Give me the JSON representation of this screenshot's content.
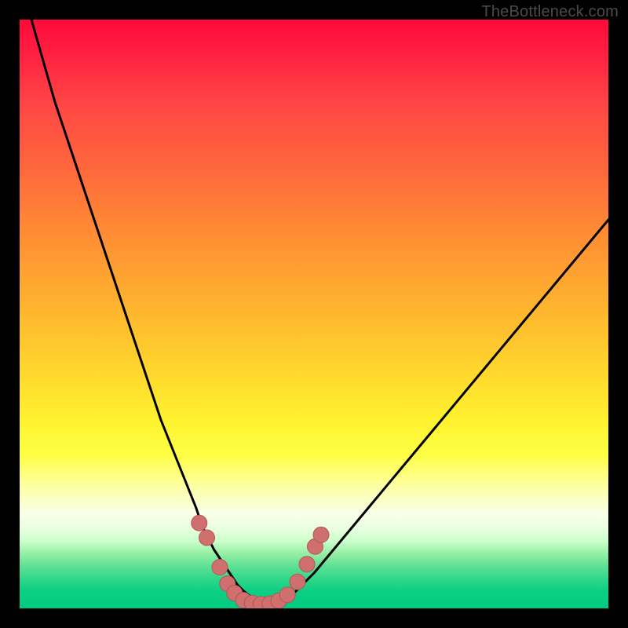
{
  "watermark": {
    "text": "TheBottleneck.com"
  },
  "colors": {
    "frame": "#000000",
    "curve": "#000000",
    "marker_fill": "#cf6f6e",
    "marker_stroke": "#b35655",
    "gradient_top": "#ff0a3a",
    "gradient_bottom": "#00cb80"
  },
  "chart_data": {
    "type": "line",
    "title": "",
    "xlabel": "",
    "ylabel": "",
    "xlim": [
      0,
      100
    ],
    "ylim": [
      0,
      100
    ],
    "grid": false,
    "legend": false,
    "series": [
      {
        "name": "bottleneck-curve",
        "x": [
          2,
          4,
          6,
          8,
          10,
          12,
          14,
          16,
          18,
          20,
          22,
          24,
          26,
          28,
          30,
          31,
          32,
          33,
          34,
          35,
          36,
          37,
          38,
          39,
          40,
          42,
          44,
          46,
          50,
          55,
          60,
          65,
          70,
          75,
          80,
          85,
          90,
          95,
          100
        ],
        "y": [
          100,
          93,
          86,
          80,
          74,
          68,
          62,
          56,
          50,
          44,
          38,
          32,
          27,
          22,
          17,
          14,
          12,
          10,
          8.5,
          7,
          5.5,
          4,
          3,
          2.2,
          1.5,
          0.6,
          0.6,
          2.0,
          6.0,
          12,
          18,
          24,
          30,
          36,
          42,
          48,
          54,
          60,
          66
        ]
      }
    ],
    "markers": [
      {
        "x": 30.5,
        "y": 14.5
      },
      {
        "x": 31.8,
        "y": 12.0
      },
      {
        "x": 34.0,
        "y": 7.0
      },
      {
        "x": 35.3,
        "y": 4.2
      },
      {
        "x": 36.5,
        "y": 2.6
      },
      {
        "x": 38.0,
        "y": 1.4
      },
      {
        "x": 39.5,
        "y": 0.9
      },
      {
        "x": 41.0,
        "y": 0.7
      },
      {
        "x": 42.5,
        "y": 0.8
      },
      {
        "x": 44.0,
        "y": 1.3
      },
      {
        "x": 45.5,
        "y": 2.3
      },
      {
        "x": 47.2,
        "y": 4.5
      },
      {
        "x": 48.8,
        "y": 7.5
      },
      {
        "x": 50.2,
        "y": 10.5
      },
      {
        "x": 51.2,
        "y": 12.5
      }
    ],
    "marker_radius_px": 10,
    "curve_stroke_px": 3
  }
}
